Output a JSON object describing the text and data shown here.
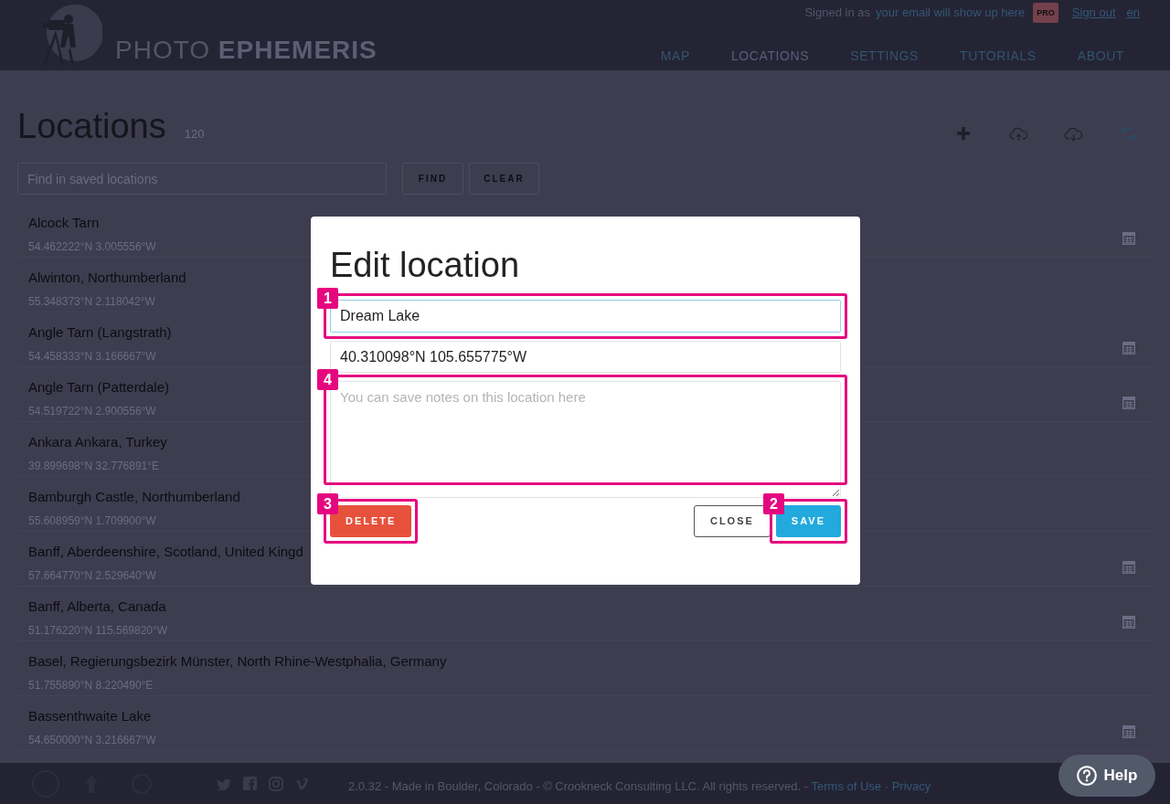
{
  "header": {
    "logo_text": "PHOTO **EPHEMERIS**",
    "account": {
      "prefix": "Signed in as",
      "email": "your email will show up here",
      "badge": "PRO",
      "sign_out": "Sign out",
      "language": "en"
    },
    "nav": [
      {
        "label": "MAP",
        "selected": false
      },
      {
        "label": "LOCATIONS",
        "selected": true
      },
      {
        "label": "SETTINGS",
        "selected": false
      },
      {
        "label": "TUTORIALS",
        "selected": false
      },
      {
        "label": "ABOUT",
        "selected": false
      }
    ]
  },
  "page": {
    "title": "Locations",
    "count": "120",
    "search": {
      "placeholder": "Find in saved locations"
    },
    "buttons": [
      "FIND",
      "CLEAR"
    ]
  },
  "locations": [
    {
      "name": "Alcock Tarn",
      "coordinates": "54.462222°N 3.005556°W",
      "calendar_icon": true
    },
    {
      "name": "Alwinton, Northumberland",
      "coordinates": "55.348373°N 2.118042°W",
      "calendar_icon": false
    },
    {
      "name": "Angle Tarn (Langstrath)",
      "coordinates": "54.458333°N 3.166667°W",
      "calendar_icon": true
    },
    {
      "name": "Angle Tarn (Patterdale)",
      "coordinates": "54.519722°N 2.900556°W",
      "calendar_icon": true
    },
    {
      "name": "Ankara Ankara, Turkey",
      "coordinates": "39.899698°N 32.776891°E",
      "calendar_icon": false
    },
    {
      "name": "Bamburgh Castle, Northumberland",
      "coordinates": "55.608959°N 1.709900°W",
      "calendar_icon": false
    },
    {
      "name": "Banff, Aberdeenshire, Scotland, United Kingd",
      "coordinates": "57.664770°N 2.529640°W",
      "calendar_icon": true
    },
    {
      "name": "Banff, Alberta, Canada",
      "coordinates": "51.176220°N 115.569820°W",
      "calendar_icon": true
    },
    {
      "name": "Basel, Regierungsbezirk Münster, North Rhine-Westphalia, Germany",
      "coordinates": "51.755890°N 8.220490°E",
      "calendar_icon": false
    },
    {
      "name": "Bassenthwaite Lake",
      "coordinates": "54.650000°N 3.216667°W",
      "calendar_icon": true
    }
  ],
  "modal": {
    "title": "Edit location",
    "fields": [
      {
        "kind": "input",
        "value": "Dream Lake",
        "focused": true,
        "callout": "1"
      },
      {
        "kind": "input",
        "value": "40.310098°N 105.655775°W",
        "focused": false
      },
      {
        "kind": "textarea",
        "placeholder": "You can save notes on this location here",
        "focused": false,
        "callout": "4"
      }
    ],
    "buttons": [
      {
        "label": "DELETE",
        "kind": "danger",
        "callout": "3"
      },
      {
        "label": "CLOSE",
        "kind": "outline"
      },
      {
        "label": "SAVE",
        "kind": "primary",
        "callout": "2"
      }
    ]
  },
  "footer": {
    "parts": [
      {
        "kind": "text",
        "text": "2.0.32 - Made in Boulder, Colorado - © Crookneck Consulting LLC. All rights reserved. -"
      },
      {
        "kind": "link",
        "text": "Terms of Use"
      },
      {
        "kind": "text",
        "text": "·"
      },
      {
        "kind": "link",
        "text": "Privacy"
      }
    ]
  },
  "help_button": {
    "label": "Help"
  }
}
